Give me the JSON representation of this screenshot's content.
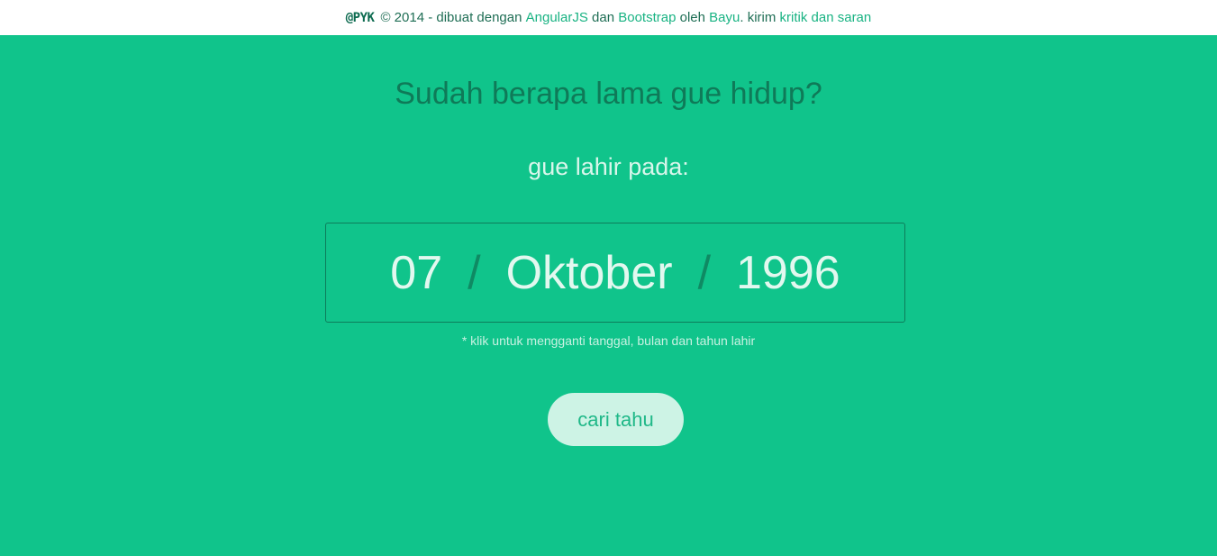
{
  "footer": {
    "logo": "@PYK",
    "copyright": "© 2014 - dibuat dengan",
    "link_angular": "AngularJS",
    "and": "dan",
    "link_bootstrap": "Bootstrap",
    "by": "oleh",
    "link_author": "Bayu",
    "send": ". kirim",
    "link_feedback": "kritik dan saran"
  },
  "main": {
    "headline": "Sudah berapa lama gue hidup?",
    "subhead": "gue lahir pada:",
    "date": {
      "day": "07",
      "month": "Oktober",
      "year": "1996",
      "separator": "/"
    },
    "hint": "* klik untuk mengganti tanggal, bulan dan tahun lahir",
    "button_label": "cari tahu"
  },
  "colors": {
    "background": "#10c48b",
    "footer_background": "#ffffff",
    "link": "#19b383",
    "button_background": "#cdf3e5"
  }
}
